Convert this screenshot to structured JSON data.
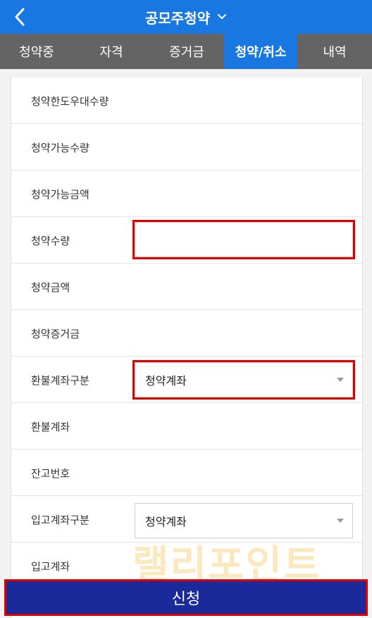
{
  "header": {
    "title": "공모주청약"
  },
  "tabs": [
    "청약중",
    "자격",
    "증거금",
    "청약/취소",
    "내역"
  ],
  "rows": [
    {
      "label": "청약한도우대수량"
    },
    {
      "label": "청약가능수량"
    },
    {
      "label": "청약가능금액"
    },
    {
      "label": "청약수량",
      "input_value": ""
    },
    {
      "label": "청약금액"
    },
    {
      "label": "청약증거금"
    },
    {
      "label": "환불계좌구분",
      "select_value": "청약계좌"
    },
    {
      "label": "환불계좌"
    },
    {
      "label": "잔고번호"
    },
    {
      "label": "입고계좌구분",
      "select_value": "청약계좌"
    },
    {
      "label": "입고계좌"
    }
  ],
  "submit_label": "신청",
  "watermark": "랠리포인트",
  "colors": {
    "primary": "#1877e0",
    "tabbar": "#646464",
    "submit": "#1a2a9a",
    "highlight": "#e00000"
  }
}
